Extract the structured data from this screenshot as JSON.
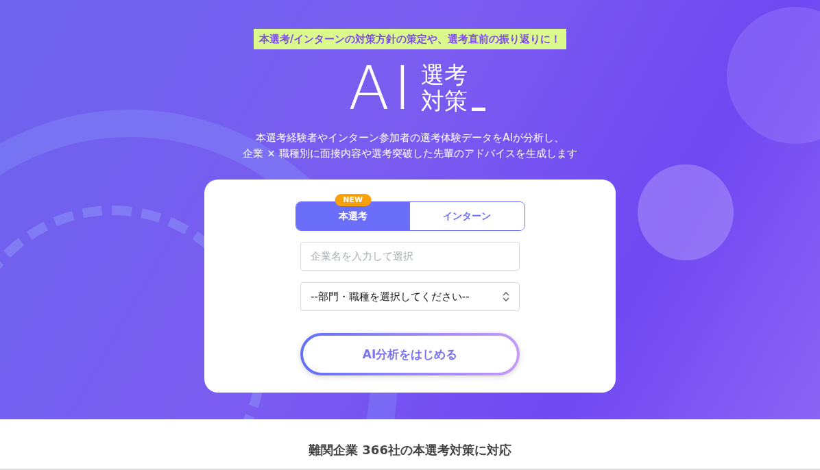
{
  "hero": {
    "tagline": "本選考/インターンの対策方針の策定や、選考直前の振り返りに！",
    "logo": {
      "letters": "AI",
      "line_1": "選考",
      "line_2": "対策"
    },
    "description": [
      "本選考経験者やインターン参加者の選考体験データをAIが分析し、",
      "企業 × 職種別に面接内容や選考突破した先輩のアドバイスを生成します"
    ]
  },
  "form": {
    "tabs": [
      {
        "label": "本選考",
        "selected": true,
        "badge": "NEW"
      },
      {
        "label": "インターン",
        "selected": false
      }
    ],
    "company_field": {
      "placeholder": "企業名を入力して選択"
    },
    "job_select": {
      "value": "--部門・職種を選択してください--"
    },
    "submit_button": "AI分析をはじめる"
  },
  "section_heading": "難関企業 366社の本選考対策に対応"
}
